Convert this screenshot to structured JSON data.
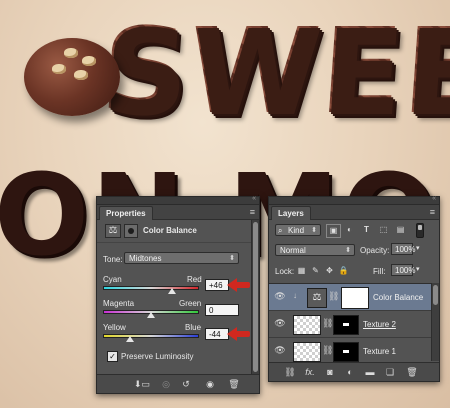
{
  "artwork": {
    "word_top": "SWEE",
    "word_bottom": "ON MO"
  },
  "properties": {
    "tab_label": "Properties",
    "panel_menu_icon": "panel-menu-icon",
    "adjustment_name": "Color Balance",
    "tone_label": "Tone:",
    "tone_value": "Midtones",
    "sliders": [
      {
        "left": "Cyan",
        "right": "Red",
        "value": "+46",
        "level": 0.73
      },
      {
        "left": "Magenta",
        "right": "Green",
        "value": "0",
        "level": 0.5
      },
      {
        "left": "Yellow",
        "right": "Blue",
        "value": "-44",
        "level": 0.28
      }
    ],
    "preserve_luminosity_label": "Preserve Luminosity",
    "preserve_luminosity_checked": true,
    "scroll_level": 0.0
  },
  "layers": {
    "tab_label": "Layers",
    "filter_label": "Kind",
    "blend_mode": "Normal",
    "opacity_label": "Opacity:",
    "opacity_value": "100%",
    "lock_label": "Lock:",
    "fill_label": "Fill:",
    "fill_value": "100%",
    "items": [
      {
        "name": "Color Balance",
        "type": "adjustment",
        "selected": true
      },
      {
        "name": "Texture 2",
        "type": "texture",
        "selected": false
      },
      {
        "name": "Texture 1",
        "type": "texture",
        "selected": false
      }
    ]
  },
  "colors": {
    "panel_bg": "#535353",
    "selected_row": "#6b7a91",
    "annotation_arrow": "#d0281f"
  }
}
